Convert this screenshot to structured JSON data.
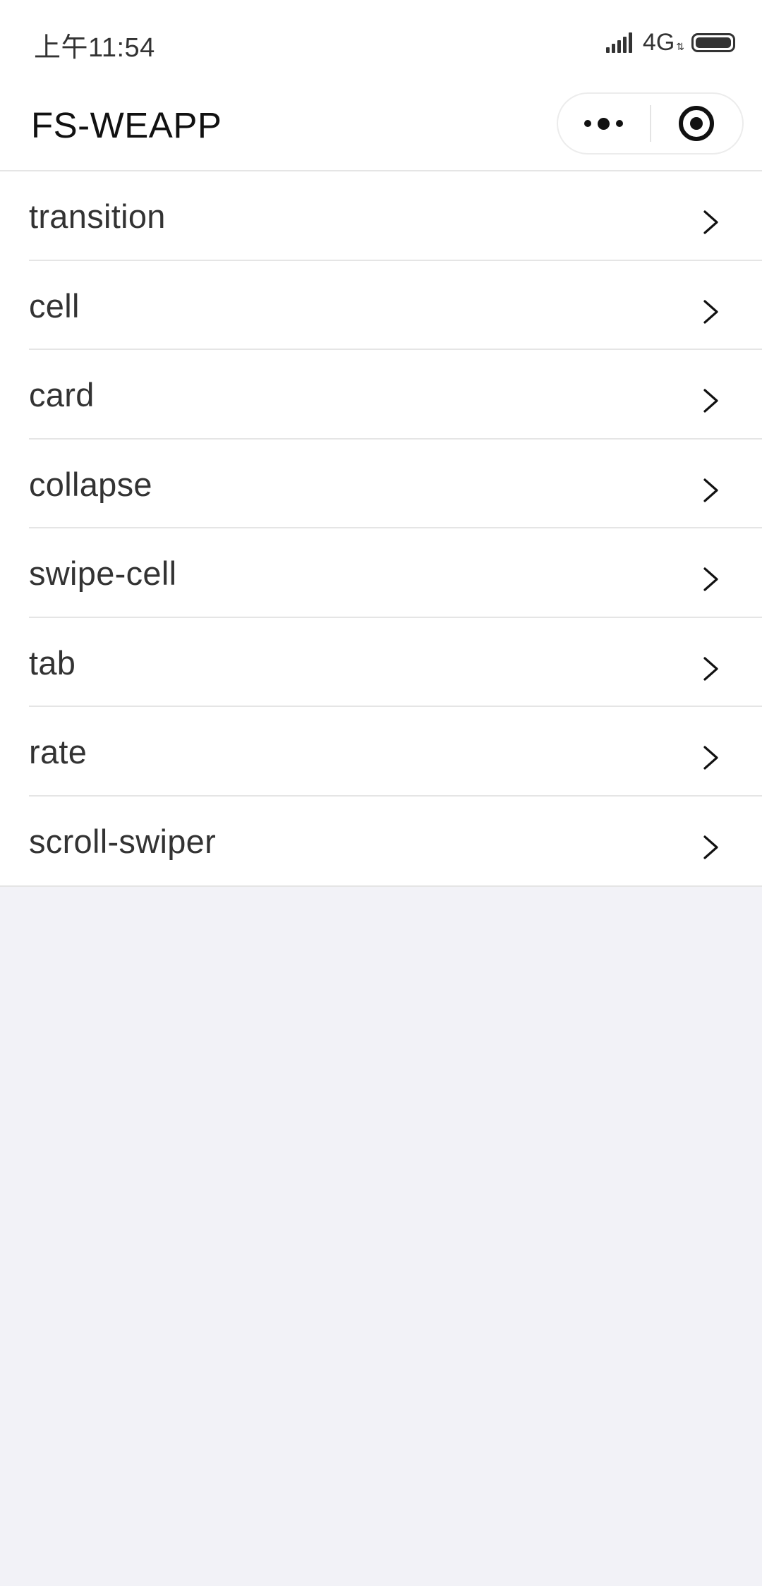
{
  "status_bar": {
    "time": "上午11:54",
    "network": "4G",
    "network_arrows": "⇅",
    "signal_icon": "signal-icon",
    "battery_icon": "battery-icon"
  },
  "nav_bar": {
    "title": "FS-WEAPP",
    "more_icon": "more-icon",
    "close_icon": "close-icon"
  },
  "menu": {
    "items": [
      {
        "label": "transition"
      },
      {
        "label": "cell"
      },
      {
        "label": "card"
      },
      {
        "label": "collapse"
      },
      {
        "label": "swipe-cell"
      },
      {
        "label": "tab"
      },
      {
        "label": "rate"
      },
      {
        "label": "scroll-swiper"
      }
    ]
  },
  "colors": {
    "page_background": "#f2f2f7",
    "surface": "#ffffff",
    "divider": "#e5e5e5",
    "text_primary": "#333333"
  }
}
